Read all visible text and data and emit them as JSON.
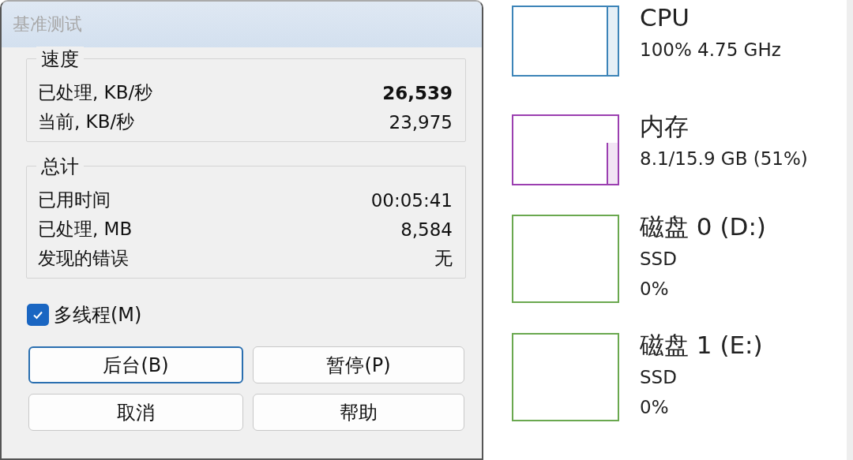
{
  "dialog": {
    "title": "基准测试",
    "groups": [
      {
        "title": "速度",
        "rows": [
          {
            "label": "已处理, KB/秒",
            "value": "26,539",
            "bold": true
          },
          {
            "label": "当前, KB/秒",
            "value": "23,975",
            "bold": false
          }
        ]
      },
      {
        "title": "总计",
        "rows": [
          {
            "label": "已用时间",
            "value": "00:05:41",
            "bold": false
          },
          {
            "label": "已处理, MB",
            "value": "8,584",
            "bold": false
          },
          {
            "label": "发现的错误",
            "value": "无",
            "bold": false
          }
        ]
      }
    ],
    "checkbox": {
      "label": "多线程(M)",
      "checked": true
    },
    "buttons": [
      {
        "label": "后台(B)",
        "focused": true
      },
      {
        "label": "暂停(P)",
        "focused": false
      },
      {
        "label": "取消",
        "focused": false
      },
      {
        "label": "帮助",
        "focused": false
      }
    ]
  },
  "performance": [
    {
      "kind": "cpu",
      "title": "CPU",
      "lines": [
        "100% 4.75 GHz"
      ],
      "color": "#3c84b8"
    },
    {
      "kind": "memory",
      "title": "内存",
      "lines": [
        "8.1/15.9 GB (51%)"
      ],
      "color": "#9b3fb0"
    },
    {
      "kind": "disk",
      "title": "磁盘 0 (D:)",
      "lines": [
        "SSD",
        "0%"
      ],
      "color": "#6aa84f"
    },
    {
      "kind": "disk",
      "title": "磁盘 1 (E:)",
      "lines": [
        "SSD",
        "0%"
      ],
      "color": "#6aa84f"
    }
  ]
}
